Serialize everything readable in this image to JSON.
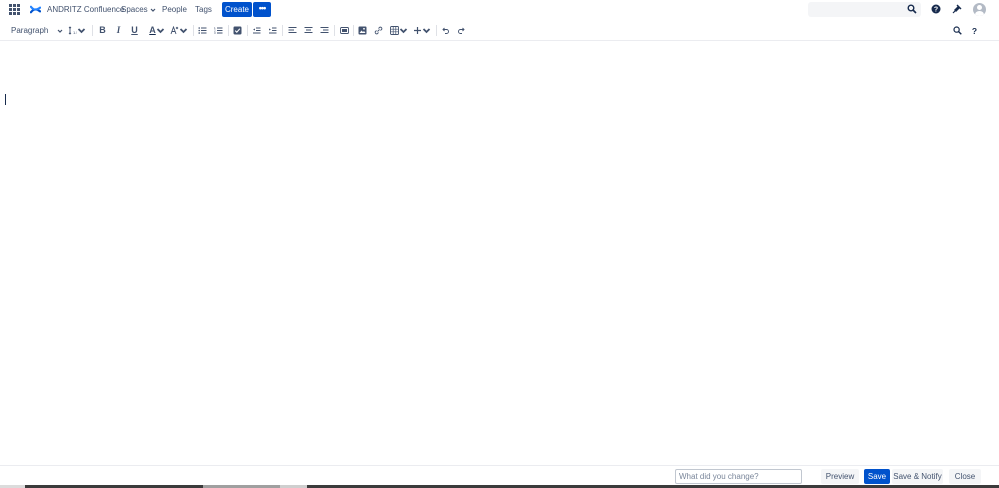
{
  "topbar": {
    "product_name": "ANDRITZ Confluence",
    "nav": {
      "spaces": "Spaces",
      "people": "People",
      "tags": "Tags"
    },
    "create_label": "Create",
    "more_label": "•••",
    "search_placeholder": "",
    "icons": [
      "app-switcher-icon",
      "confluence-logo-icon",
      "search-icon",
      "help-icon",
      "notifications-icon",
      "avatar-icon"
    ]
  },
  "toolbar": {
    "paragraph_label": "Paragraph",
    "bold_label": "B",
    "italic_label": "I",
    "underline_label": "U",
    "text_color_label": "A",
    "icons": [
      "line-height-icon",
      "text-color-icon",
      "clear-format-icon",
      "bullet-list-icon",
      "numbered-list-icon",
      "task-list-icon",
      "outdent-icon",
      "indent-icon",
      "align-left-icon",
      "align-center-icon",
      "align-right-icon",
      "layout-icon",
      "image-icon",
      "link-icon",
      "table-icon",
      "insert-more-icon",
      "undo-icon",
      "redo-icon",
      "find-replace-icon",
      "help-icon"
    ]
  },
  "footer": {
    "change_placeholder": "What did you change?",
    "preview_label": "Preview",
    "save_label": "Save",
    "save_notify_label": "Save & Notify",
    "close_label": "Close"
  },
  "colors": {
    "primary": "#0052cc",
    "text": "#42526e",
    "border": "#ebecf0"
  }
}
